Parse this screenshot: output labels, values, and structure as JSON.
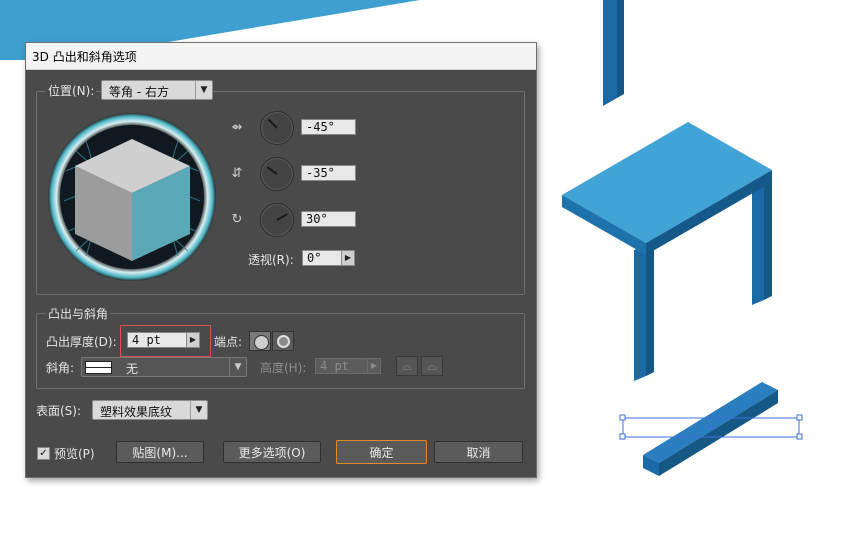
{
  "dialog": {
    "title": "3D 凸出和斜角选项",
    "position": {
      "label": "位置(N):",
      "value": "等角 - 右方",
      "rotation_x": "-45°",
      "rotation_y": "-35°",
      "rotation_z": "30°",
      "perspective_label": "透视(R):",
      "perspective_value": "0°"
    },
    "extrude": {
      "group_label": "凸出与斜角",
      "depth_label": "凸出厚度(D):",
      "depth_value": "4 pt",
      "cap_label": "端点:",
      "bevel_label": "斜角:",
      "bevel_value": "无",
      "height_label": "高度(H):",
      "height_value": "4 pt"
    },
    "surface": {
      "label": "表面(S):",
      "value": "塑料效果底纹"
    },
    "buttons": {
      "preview_label": "预览(P)",
      "preview_checked": true,
      "map": "贴图(M)...",
      "more_options": "更多选项(O)",
      "ok": "确定",
      "cancel": "取消"
    }
  },
  "colors": {
    "accent": "#e58a2e",
    "highlight": "#d9534f",
    "dialog_bg": "#4a4a4a",
    "artwork_blue": "#3fa0d1"
  }
}
